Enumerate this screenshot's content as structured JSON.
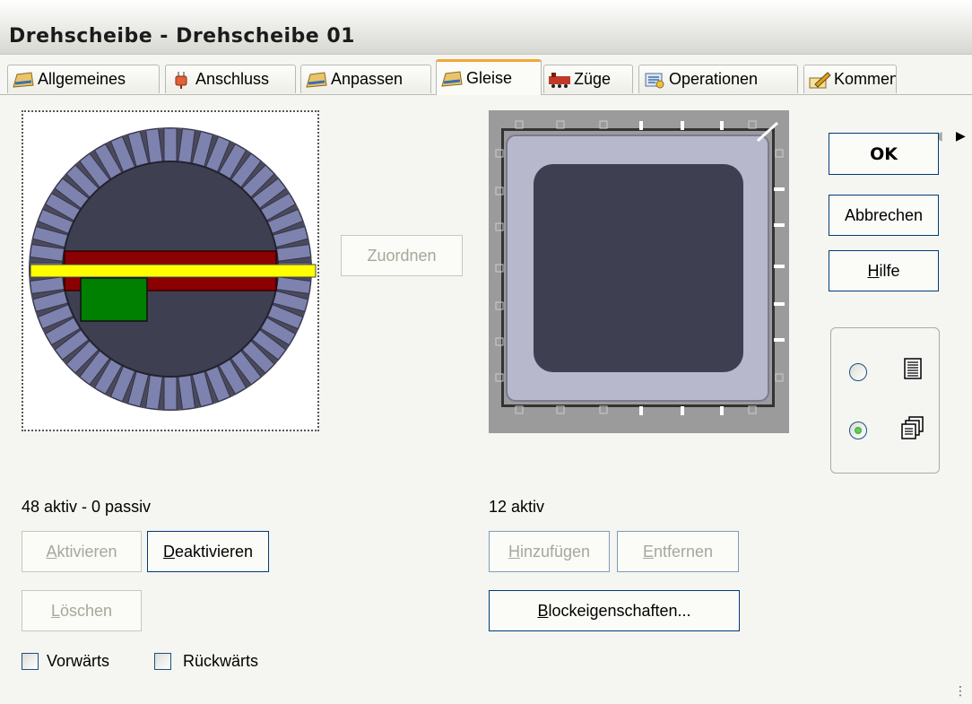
{
  "window": {
    "title": "Drehscheibe - Drehscheibe 01"
  },
  "tabs": [
    {
      "label": "Allgemeines",
      "icon": "hat-icon"
    },
    {
      "label": "Anschluss",
      "icon": "plug-icon"
    },
    {
      "label": "Anpassen",
      "icon": "hat-icon"
    },
    {
      "label": "Gleise",
      "icon": "hat-icon",
      "active": true
    },
    {
      "label": "Züge",
      "icon": "train-icon"
    },
    {
      "label": "Operationen",
      "icon": "gear-icon"
    },
    {
      "label": "Kommentar",
      "icon": "pencil-icon"
    }
  ],
  "turntable": {
    "status": "48 aktiv - 0 passiv",
    "tracks": 48,
    "activate_label": "Aktivieren",
    "deactivate_label": "Deaktivieren",
    "delete_label": "Löschen",
    "forward_label": "Vorwärts",
    "backward_label": "Rückwärts"
  },
  "assign_label": "Zuordnen",
  "block": {
    "status": "12 aktiv",
    "add_label": "Hinzufügen",
    "remove_label": "Entfernen",
    "properties_label": "Blockeigenschaften..."
  },
  "side": {
    "ok_label": "OK",
    "cancel_label": "Abbrechen",
    "help_label": "Hilfe",
    "view_options": [
      {
        "icon": "list-icon",
        "selected": false
      },
      {
        "icon": "cascade-icon",
        "selected": true
      }
    ]
  },
  "colors": {
    "tab_accent": "#f2a635",
    "track": "#7e82ae",
    "pit": "#3f3f52",
    "bridge": "#8b0000",
    "rail": "#ffff00",
    "cabin": "#008000"
  }
}
